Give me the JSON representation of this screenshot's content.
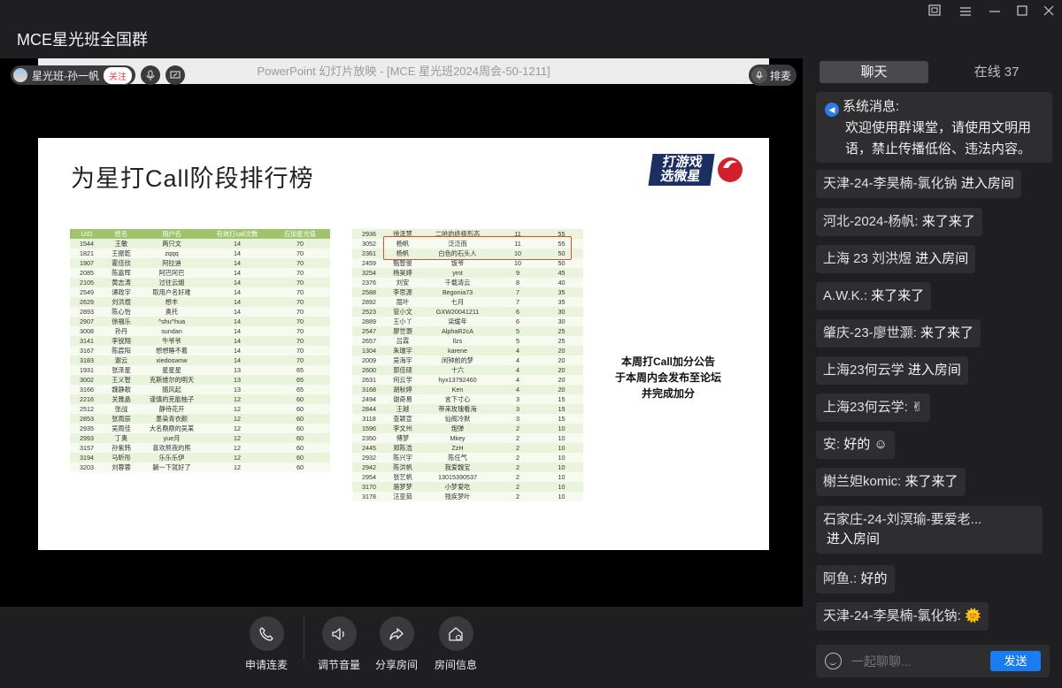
{
  "window": {
    "title": "MCE星光班全国群",
    "controls": [
      "restore-icon",
      "minimize-icon",
      "maximize-icon",
      "close-icon"
    ]
  },
  "host": {
    "name": "星光班-孙一帆",
    "follow_label": "关注"
  },
  "ppt_bar": {
    "title": "PowerPoint 幻灯片放映 - [MCE 星光班2024周会-50-1211]"
  },
  "queue_button": {
    "label": "排麦"
  },
  "slide": {
    "title": "为星打Call阶段排行榜",
    "logo_text": "打游戏 选微星",
    "notice_lines": [
      "本周打Call加分公告",
      "于本周内会发布至论坛",
      "并完成加分"
    ],
    "left_table": {
      "headers": [
        "UID",
        "姓名",
        "用户名",
        "有效打call次数",
        "应加星光值"
      ],
      "rows": [
        [
          "1544",
          "王敏",
          "两只文",
          "14",
          "70"
        ],
        [
          "1821",
          "王振乾",
          "zqqq",
          "14",
          "70"
        ],
        [
          "1907",
          "霍佳欣",
          "阿拉迪",
          "14",
          "70"
        ],
        [
          "2085",
          "陈嘉晖",
          "阿巴阿巴",
          "14",
          "70"
        ],
        [
          "2105",
          "黄志涛",
          "过往云烟",
          "14",
          "70"
        ],
        [
          "2549",
          "谭政宇",
          "取用户名好难",
          "14",
          "70"
        ],
        [
          "2629",
          "刘洪煜",
          "想丰",
          "14",
          "70"
        ],
        [
          "2893",
          "陈心怡",
          "奥托",
          "14",
          "70"
        ],
        [
          "2907",
          "徐福乐",
          "^shu^hua",
          "14",
          "70"
        ],
        [
          "3008",
          "孙丹",
          "sundan",
          "14",
          "70"
        ],
        [
          "3141",
          "李锐翔",
          "牛爷爷",
          "14",
          "70"
        ],
        [
          "3167",
          "陈宸阳",
          "想想睡不着",
          "14",
          "70"
        ],
        [
          "3183",
          "谢云",
          "xiedoswnw",
          "14",
          "70"
        ],
        [
          "1931",
          "张泽星",
          "星星星",
          "13",
          "65"
        ],
        [
          "3002",
          "王义智",
          "克斯维尔的明天",
          "13",
          "65"
        ],
        [
          "3166",
          "魏静歌",
          "随风起",
          "13",
          "65"
        ],
        [
          "2216",
          "关雅晶",
          "谨慎的克能柚子",
          "12",
          "60"
        ],
        [
          "2512",
          "张战",
          "静待花开",
          "12",
          "60"
        ],
        [
          "2853",
          "张雨辰",
          "墨染青衣颜",
          "12",
          "60"
        ],
        [
          "2935",
          "吴雨佳",
          "大名鼎鼎的吴某",
          "12",
          "60"
        ],
        [
          "2993",
          "丁奥",
          "yue月",
          "12",
          "60"
        ],
        [
          "3157",
          "孙紫韩",
          "喜欢熬夜的熊",
          "12",
          "60"
        ],
        [
          "3194",
          "马昕彤",
          "乐乐乐伊",
          "12",
          "60"
        ],
        [
          "3203",
          "刘蓉蓉",
          "躺一下就好了",
          "12",
          "60"
        ]
      ]
    },
    "right_table": {
      "rows": [
        [
          "2936",
          "徐泽慧",
          "二哈的终极形态",
          "11",
          "55"
        ],
        [
          "3052",
          "杨帆",
          "泛泛而",
          "11",
          "55"
        ],
        [
          "2361",
          "杨帆",
          "白色的石头人",
          "10",
          "50"
        ],
        [
          "2459",
          "甄智俊",
          "饭爷",
          "10",
          "50"
        ],
        [
          "3254",
          "杨昊婷",
          "ymt",
          "9",
          "45"
        ],
        [
          "2376",
          "刘安",
          "千载清云",
          "8",
          "40"
        ],
        [
          "2588",
          "李思源",
          "Begonia73",
          "7",
          "35"
        ],
        [
          "2892",
          "屈叶",
          "七月",
          "7",
          "35"
        ],
        [
          "2523",
          "管小文",
          "GXW20041211",
          "6",
          "30"
        ],
        [
          "2889",
          "王小丫",
          "柒缓年",
          "6",
          "30"
        ],
        [
          "2547",
          "廖世灏",
          "AlphaR2cA",
          "5",
          "25"
        ],
        [
          "2657",
          "吕霖",
          "llzs",
          "5",
          "25"
        ],
        [
          "1304",
          "朱瑞宇",
          "karene",
          "4",
          "20"
        ],
        [
          "2009",
          "吴海宇",
          "闲钟前的梦",
          "4",
          "20"
        ],
        [
          "2600",
          "郭佳硕",
          "十六",
          "4",
          "20"
        ],
        [
          "2631",
          "何云学",
          "hyx13792460",
          "4",
          "20"
        ],
        [
          "3168",
          "胡秋婷",
          "Ken",
          "4",
          "20"
        ],
        [
          "2494",
          "谢奇易",
          "言下寸心",
          "3",
          "15"
        ],
        [
          "2844",
          "王越",
          "带来玫瑰看海",
          "3",
          "15"
        ],
        [
          "3118",
          "查颖宣",
          "仙阁冷默",
          "3",
          "15"
        ],
        [
          "1596",
          "李文州",
          "炮弹",
          "2",
          "10"
        ],
        [
          "2350",
          "傅梦",
          "Mkey",
          "2",
          "10"
        ],
        [
          "2445",
          "郑陈浩",
          "ZzH",
          "2",
          "10"
        ],
        [
          "2932",
          "陈兴宇",
          "陈任气",
          "2",
          "10"
        ],
        [
          "2942",
          "陈洪帆",
          "我爱魏宝",
          "2",
          "10"
        ],
        [
          "2954",
          "张艺帆",
          "13015390537",
          "2",
          "10"
        ],
        [
          "3170",
          "骆梦梦",
          "小梦爱吃",
          "2",
          "10"
        ],
        [
          "3178",
          "汪亚茹",
          "残疾梦叶",
          "2",
          "10"
        ]
      ]
    }
  },
  "controls": [
    {
      "label": "申请连麦",
      "icon": "phone-icon"
    },
    {
      "label": "调节音量",
      "icon": "speaker-icon"
    },
    {
      "label": "分享房间",
      "icon": "share-icon"
    },
    {
      "label": "房间信息",
      "icon": "house-info-icon"
    }
  ],
  "sidebar": {
    "tabs": {
      "chat": "聊天",
      "online": "在线 37"
    },
    "system_message": {
      "label": "系统消息:",
      "text": "欢迎使用群课堂，请使用文明用语，禁止传播低俗、违法内容。"
    },
    "messages": [
      {
        "sender": "天津-24-李昊楠-氯化钠",
        "text": " 进入房间"
      },
      {
        "sender": "河北-2024-杨帆:",
        "text": " 来了来了"
      },
      {
        "sender": "上海 23 刘洪煜",
        "text": " 进入房间"
      },
      {
        "sender": "A.W.K.:",
        "text": " 来了来了"
      },
      {
        "sender": "肇庆-23-廖世灏:",
        "text": " 来了来了"
      },
      {
        "sender": "上海23何云学",
        "text": " 进入房间"
      },
      {
        "sender": "上海23何云学:",
        "text": " ✌"
      },
      {
        "sender": "安:",
        "text": " 好的 ☺"
      },
      {
        "sender": "榭兰妲komic:",
        "text": " 来了来了"
      },
      {
        "sender": "石家庄-24-刘溟瑜-要爱老...",
        "text": "进入房间"
      },
      {
        "sender": "阿鱼.:",
        "text": " 好的"
      },
      {
        "sender": "天津-24-李昊楠-氯化钠:",
        "text": " 🌞"
      }
    ],
    "composer": {
      "placeholder": "一起聊聊...",
      "send_label": "发送"
    }
  }
}
